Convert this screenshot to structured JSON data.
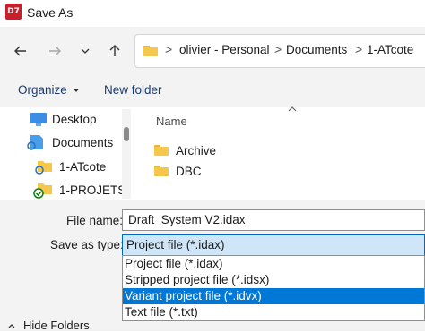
{
  "window": {
    "app_icon": "D7",
    "title": "Save As"
  },
  "nav": {
    "back_icon": "arrow-left-icon",
    "forward_icon": "arrow-right-icon",
    "recent_icon": "chevron-down-icon",
    "up_icon": "arrow-up-icon",
    "breadcrumbs": [
      "olivier - Personal",
      "Documents",
      "1-ATcote"
    ],
    "separator": ">"
  },
  "toolbar": {
    "organize_label": "Organize",
    "new_folder_label": "New folder"
  },
  "sidebar": {
    "items": [
      {
        "label": "Desktop",
        "icon": "desktop-icon"
      },
      {
        "label": "Documents",
        "icon": "documents-icon"
      },
      {
        "label": "1-ATcote",
        "icon": "folder-sync-icon"
      },
      {
        "label": "1-PROJETS",
        "icon": "folder-synced-icon"
      }
    ]
  },
  "filelist": {
    "column_name": "Name",
    "items": [
      {
        "label": "Archive",
        "icon": "folder-icon"
      },
      {
        "label": "DBC",
        "icon": "folder-icon"
      }
    ]
  },
  "form": {
    "filename_label": "File name:",
    "filename_value": "Draft_System V2.idax",
    "savetype_label": "Save as type:",
    "savetype_value": "Project file (*.idax)",
    "options": [
      "Project file (*.idax)",
      "Stripped project file (*.idsx)",
      "Variant project file (*.idvx)",
      "Text file (*.txt)"
    ],
    "selected_option_index": 2
  },
  "footer": {
    "hide_folders_label": "Hide Folders"
  },
  "colors": {
    "accent": "#0078d7",
    "app_icon_bg": "#c8202a",
    "folder": "#f5c84c"
  }
}
